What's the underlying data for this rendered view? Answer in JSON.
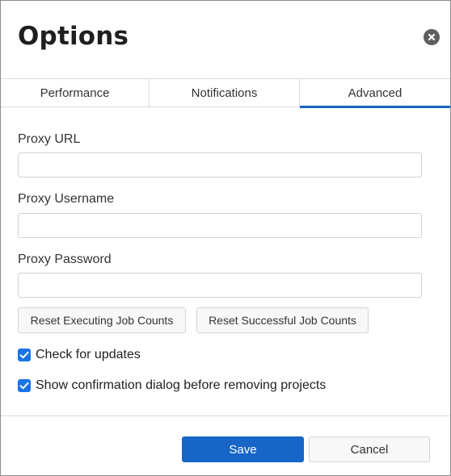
{
  "dialog": {
    "title": "Options",
    "close_icon": "close-circle-icon"
  },
  "tabs": [
    {
      "label": "Performance",
      "active": false
    },
    {
      "label": "Notifications",
      "active": false
    },
    {
      "label": "Advanced",
      "active": true
    }
  ],
  "fields": {
    "proxy_url": {
      "label": "Proxy URL",
      "value": ""
    },
    "proxy_username": {
      "label": "Proxy Username",
      "value": ""
    },
    "proxy_password": {
      "label": "Proxy Password",
      "value": ""
    }
  },
  "buttons": {
    "reset_executing": "Reset Executing Job Counts",
    "reset_successful": "Reset Successful Job Counts",
    "save": "Save",
    "cancel": "Cancel"
  },
  "checkboxes": {
    "check_updates": {
      "label": "Check for updates",
      "checked": true
    },
    "confirm_remove": {
      "label": "Show confirmation dialog before removing projects",
      "checked": true
    }
  },
  "colors": {
    "accent": "#1765c6",
    "checkbox": "#1a73e8"
  }
}
